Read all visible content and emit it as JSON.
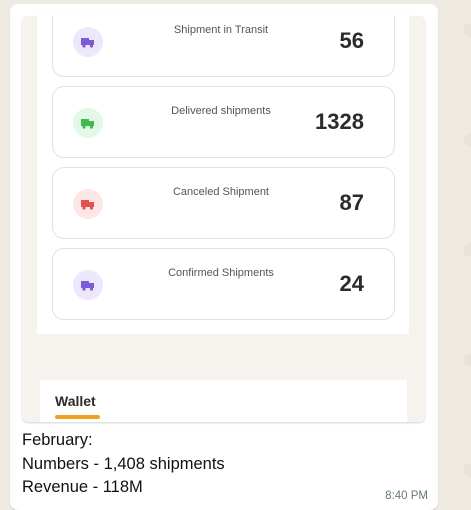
{
  "message": {
    "image": {
      "stats": [
        {
          "label": "Shipment in Transit",
          "value": "56",
          "icon": "truck-icon",
          "icon_color": "#7b5cd6",
          "icon_bg": "#ede7fb"
        },
        {
          "label": "Delivered shipments",
          "value": "1328",
          "icon": "truck-icon",
          "icon_color": "#3fb950",
          "icon_bg": "#e3f8e6"
        },
        {
          "label": "Canceled Shipment",
          "value": "87",
          "icon": "truck-icon",
          "icon_color": "#e05252",
          "icon_bg": "#fce6e6"
        },
        {
          "label": "Confirmed Shipments",
          "value": "24",
          "icon": "truck-icon",
          "icon_color": "#7b5cd6",
          "icon_bg": "#ede7fb"
        }
      ],
      "wallet_tab": "Wallet",
      "accent_color": "#f0a020"
    },
    "caption_lines": [
      "February:",
      "Numbers - 1,408 shipments",
      "Revenue - 118M"
    ],
    "time": "8:40 PM"
  }
}
